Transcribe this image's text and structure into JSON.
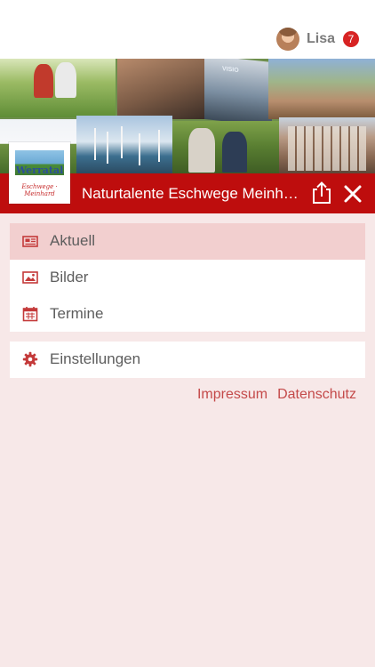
{
  "user": {
    "name": "Lisa",
    "notification_count": "7"
  },
  "banner": {
    "logo_word": "Werratal",
    "logo_sub": "Eschwege · Meinhard",
    "title": "Naturtalente Eschwege Meinhard",
    "photo_sign": "VISIO"
  },
  "menu": {
    "primary": [
      {
        "label": "Aktuell",
        "icon": "newspaper-icon",
        "active": true
      },
      {
        "label": "Bilder",
        "icon": "image-icon",
        "active": false
      },
      {
        "label": "Termine",
        "icon": "calendar-icon",
        "active": false
      }
    ],
    "settings": {
      "label": "Einstellungen",
      "icon": "gear-icon"
    }
  },
  "footer_links": {
    "impressum": "Impressum",
    "datenschutz": "Datenschutz"
  },
  "colors": {
    "brand_red": "#be0d0d",
    "accent_link": "#c44a4a",
    "background": "#f7e8e8",
    "active_item": "#f2cfcf"
  }
}
